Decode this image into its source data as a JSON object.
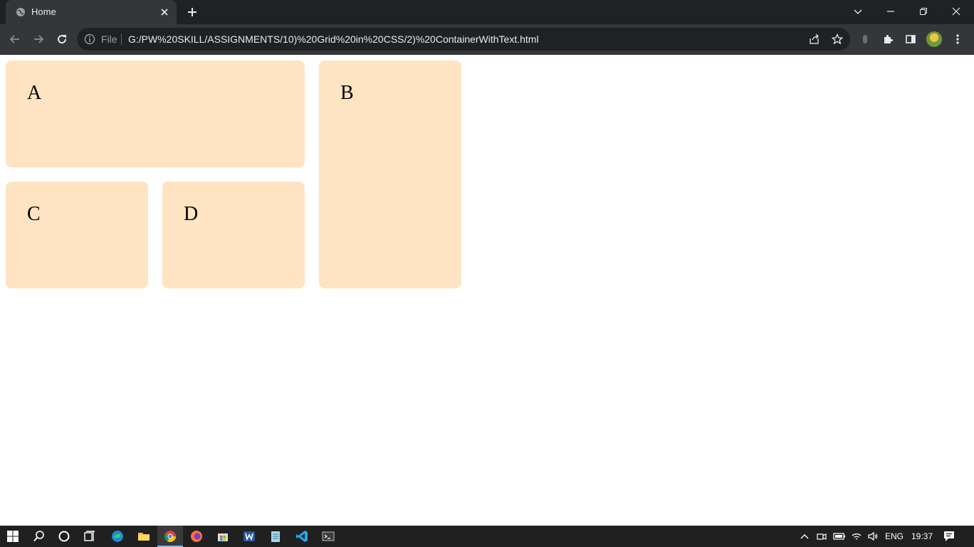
{
  "browser": {
    "tab_title": "Home",
    "scheme_label": "File",
    "url": "G:/PW%20SKILL/ASSIGNMENTS/10)%20Grid%20in%20CSS/2)%20ContainerWithText.html"
  },
  "page": {
    "box_a": "A",
    "box_b": "B",
    "box_c": "C",
    "box_d": "D",
    "box_color": "#ffe4c4"
  },
  "taskbar": {
    "apps": [
      "windows-start-icon",
      "search-icon",
      "cortana-icon",
      "task-view-icon",
      "edge-icon",
      "file-explorer-icon",
      "chrome-icon",
      "firefox-icon",
      "store-icon",
      "word-icon",
      "notepad-icon",
      "vscode-icon",
      "terminal-icon"
    ],
    "language": "ENG",
    "time": "19:37"
  }
}
